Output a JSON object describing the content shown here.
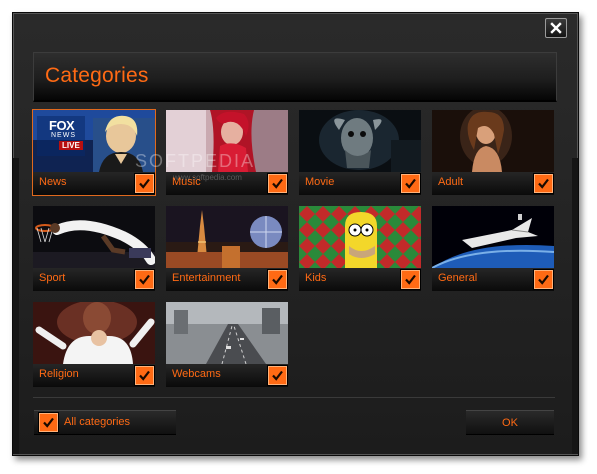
{
  "dialog": {
    "title": "Categories",
    "close_icon": "close-icon",
    "watermark": "SOFTPEDIA",
    "watermark_url": "www.softpedia.com"
  },
  "categories": [
    {
      "label": "News",
      "checked": true,
      "selected": true,
      "thumb": "news-anchor"
    },
    {
      "label": "Music",
      "checked": true,
      "selected": false,
      "thumb": "singer-red"
    },
    {
      "label": "Movie",
      "checked": true,
      "selected": false,
      "thumb": "creature"
    },
    {
      "label": "Adult",
      "checked": true,
      "selected": false,
      "thumb": "portrait"
    },
    {
      "label": "Sport",
      "checked": true,
      "selected": false,
      "thumb": "basketball-dunk"
    },
    {
      "label": "Entertainment",
      "checked": true,
      "selected": false,
      "thumb": "las-vegas"
    },
    {
      "label": "Kids",
      "checked": true,
      "selected": false,
      "thumb": "homer-cartoon"
    },
    {
      "label": "General",
      "checked": true,
      "selected": false,
      "thumb": "space-shuttle"
    },
    {
      "label": "Religion",
      "checked": true,
      "selected": false,
      "thumb": "pope"
    },
    {
      "label": "Webcams",
      "checked": true,
      "selected": false,
      "thumb": "highway-city"
    }
  ],
  "thumb_text": {
    "news_logo": "FOX",
    "news_sub": "NEWS",
    "news_live": "LIVE"
  },
  "footer": {
    "all_categories_label": "All categories",
    "all_checked": true,
    "ok_label": "OK"
  },
  "colors": {
    "accent": "#ff6a14",
    "background": "#262626",
    "selection_border": "#e0691d"
  }
}
